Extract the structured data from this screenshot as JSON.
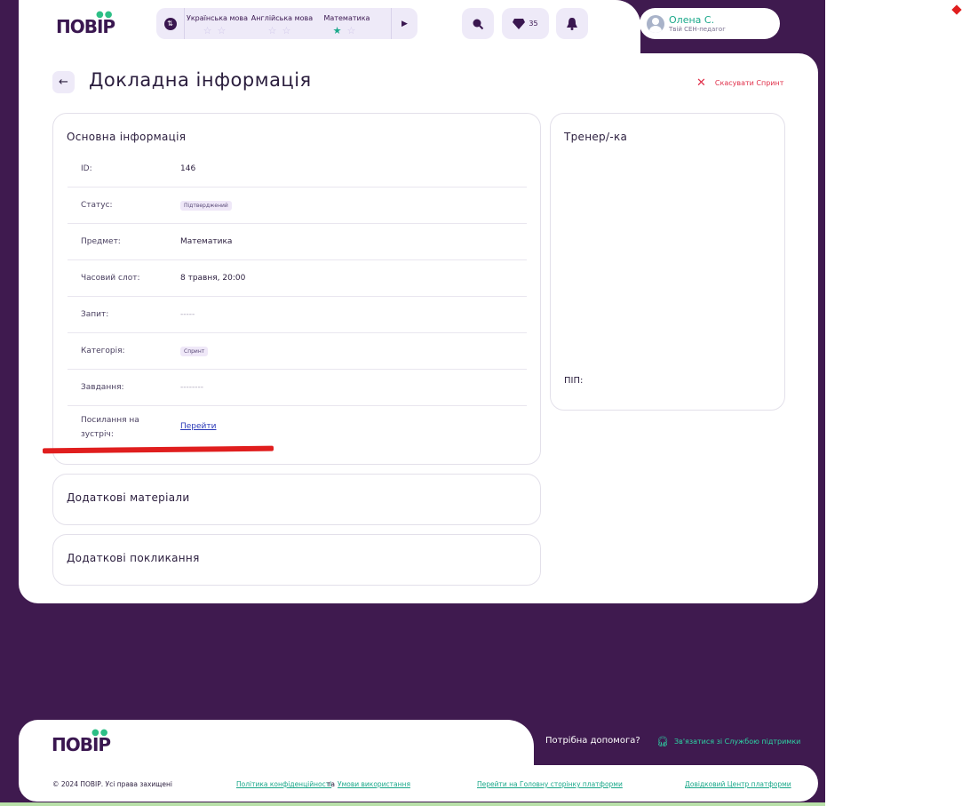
{
  "header": {
    "logo": "ПОВІР",
    "subjects": [
      {
        "name": "Українська мова",
        "stars": [
          "☆",
          "☆"
        ],
        "active": [
          false,
          false
        ]
      },
      {
        "name": "Англійська мова",
        "stars": [
          "☆",
          "☆"
        ],
        "active": [
          false,
          false
        ]
      },
      {
        "name": "Математика",
        "stars": [
          "★",
          "☆"
        ],
        "active": [
          true,
          false
        ]
      }
    ],
    "gems_count": "35",
    "user": {
      "name": "Олена С.",
      "role": "Твій СЕН-педагог"
    }
  },
  "page": {
    "title": "Докладна інформація",
    "cancel_label": "Скасувати Спринт"
  },
  "basic_info": {
    "title": "Основна інформація",
    "rows": [
      {
        "label": "ID:",
        "value": "146"
      },
      {
        "label": "Статус:",
        "value": "Підтверджений"
      },
      {
        "label": "Предмет:",
        "value": "Математика"
      },
      {
        "label": "Часовий слот:",
        "value": "8 травня, 20:00"
      },
      {
        "label": "Запит:",
        "value": "-----"
      },
      {
        "label": "Категорія:",
        "value": "Спринт"
      },
      {
        "label": "Завдання:",
        "value": "--------"
      },
      {
        "label": "Посилання на зустріч:",
        "value": "Перейти"
      }
    ]
  },
  "trainer": {
    "title": "Тренер/-ка",
    "name_label": "ПІП:"
  },
  "extra_materials": {
    "title": "Додаткові матеріали"
  },
  "extra_calls": {
    "title": "Додаткові покликання"
  },
  "footer": {
    "logo": "ПОВІР",
    "help_text": "Потрібна допомога?",
    "support_label": "Зв'язатися зі Службою підтримки",
    "copyright": "© 2024 ПОВІР. Усі права захищені",
    "privacy": "Політика конфіденційності",
    "and": "та",
    "terms": "Умови використання",
    "home": "Перейти на Головну сторінку платформи",
    "help_center": "Довідковий Центр платформи"
  },
  "colors": {
    "brand_purple": "#3f1a4f",
    "accent_green": "#1aa88a",
    "danger_red": "#e0304a"
  },
  "icons": [
    "switch-icon",
    "chevron-right-icon",
    "search-icon",
    "gem-icon",
    "bell-icon",
    "avatar-icon",
    "arrow-left-icon",
    "close-icon",
    "headset-icon"
  ]
}
